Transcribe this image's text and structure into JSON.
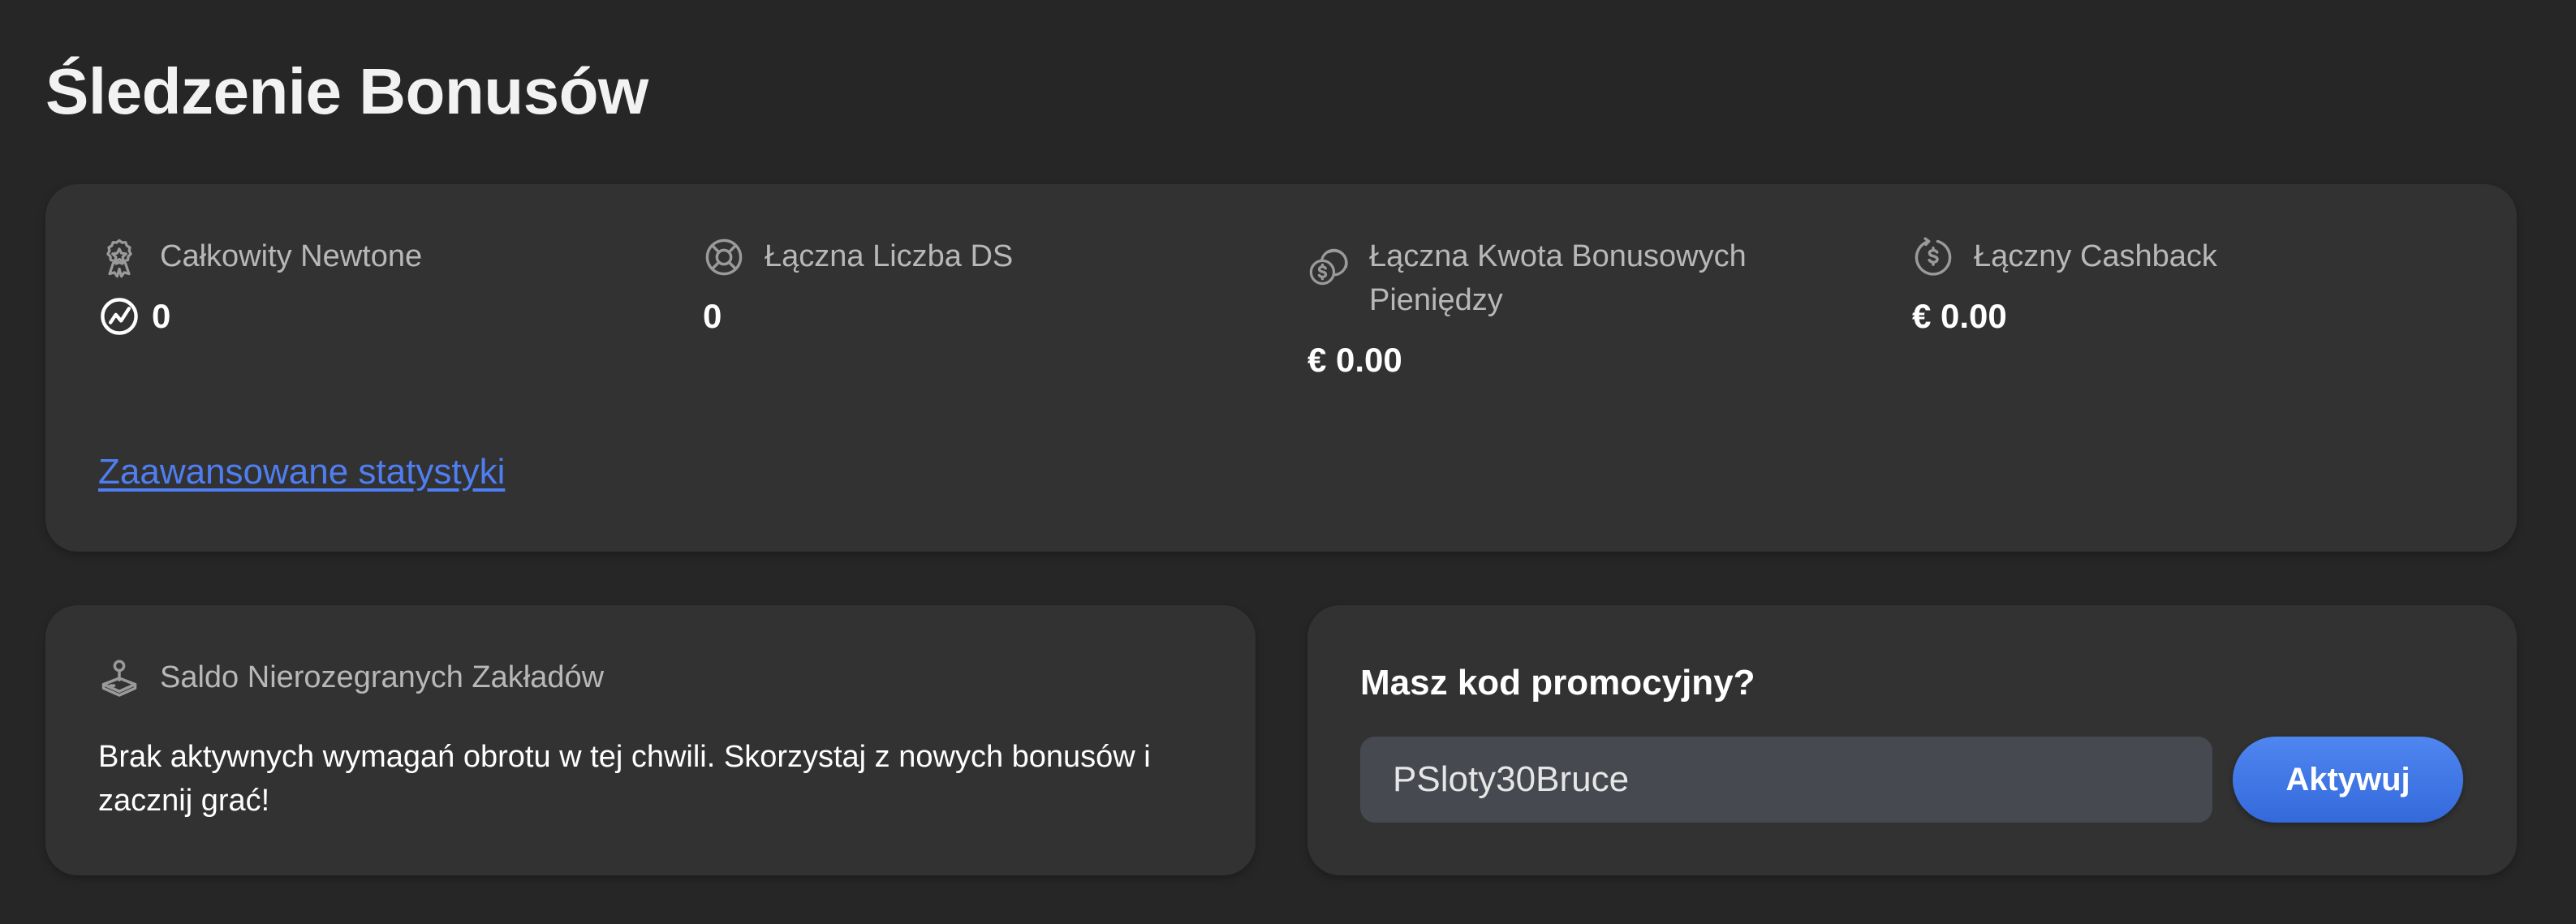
{
  "page": {
    "title": "Śledzenie Bonusów"
  },
  "stats": {
    "items": [
      {
        "label": "Całkowity Newtone",
        "value": "0",
        "icon": "award-icon",
        "value_icon": "newtone-icon"
      },
      {
        "label": "Łączna Liczba DS",
        "value": "0",
        "icon": "lifebuoy-icon"
      },
      {
        "label": "Łączna Kwota Bonusowych Pieniędzy",
        "value": "€ 0.00",
        "icon": "coins-icon"
      },
      {
        "label": "Łączny Cashback",
        "value": "€ 0.00",
        "icon": "cashback-icon"
      }
    ],
    "advanced_link": "Zaawansowane statystyki"
  },
  "wager": {
    "label": "Saldo Nierozegranych Zakładów",
    "icon": "joystick-icon",
    "message": "Brak aktywnych wymagań obrotu w tej chwili. Skorzystaj z nowych bonusów i zacznij grać!"
  },
  "promo": {
    "title": "Masz kod promocyjny?",
    "input_value": "PSloty30Bruce",
    "button_label": "Aktywuj"
  },
  "colors": {
    "background": "#262626",
    "card": "#323232",
    "link": "#4f7ef2",
    "button": "#3d74e6",
    "input": "#474951"
  }
}
